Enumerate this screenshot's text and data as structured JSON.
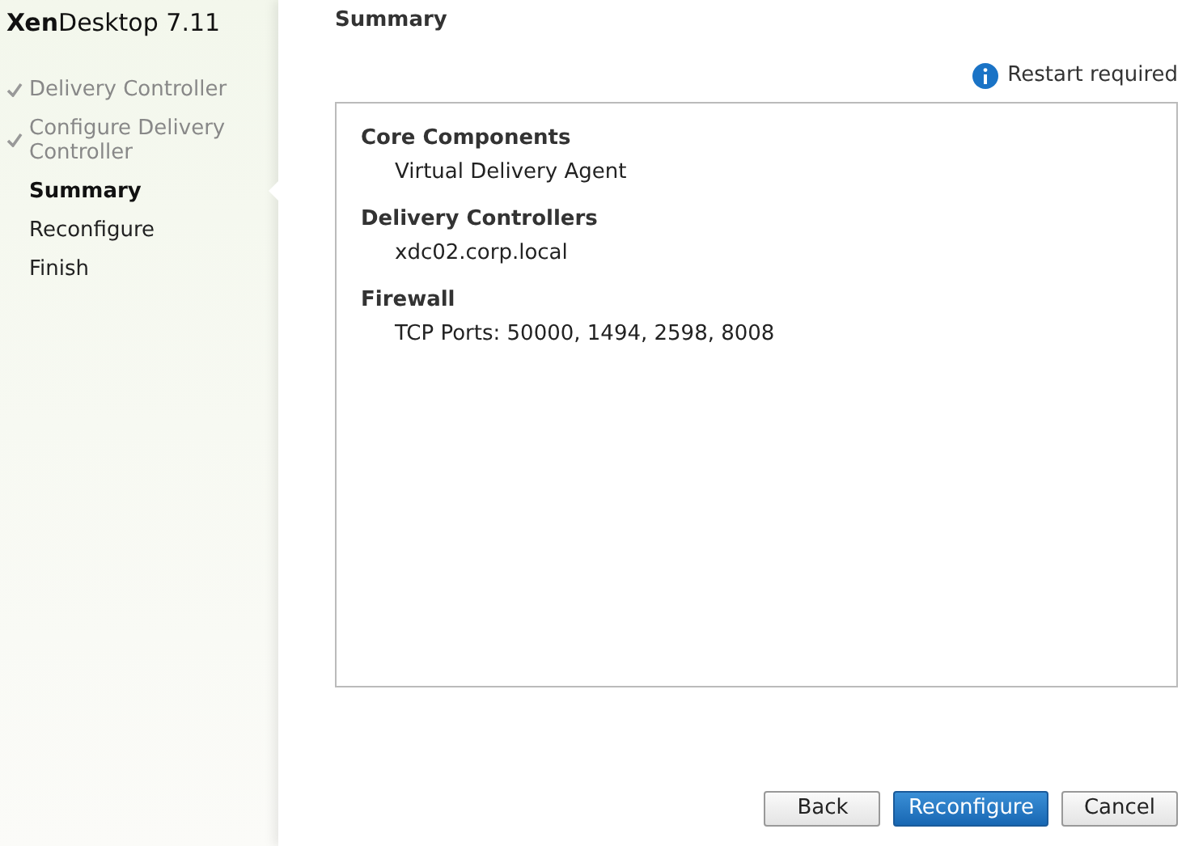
{
  "product": "**Xen**Desktop 7.11",
  "steps": [
    {
      "label": "Delivery Controller",
      "done": true,
      "selected": false
    },
    {
      "label": "Configure Delivery Controller",
      "done": true,
      "selected": false
    },
    {
      "label": "Summary",
      "done": false,
      "selected": true
    },
    {
      "label": "Reconfigure",
      "done": false,
      "selected": false
    },
    {
      "label": "Finish",
      "done": false,
      "selected": false
    }
  ],
  "page_title": "Summary",
  "notice": "Restart required",
  "summary": [
    {
      "heading": "Core Components",
      "value": "Virtual Delivery Agent"
    },
    {
      "heading": "Delivery Controllers",
      "value": "xdc02.corp.local"
    },
    {
      "heading": "Firewall",
      "value": "TCP Ports:  50000, 1494, 2598, 8008"
    }
  ],
  "buttons": [
    {
      "label": "Back",
      "primary": false
    },
    {
      "label": "Reconfigure",
      "primary": true
    },
    {
      "label": "Cancel",
      "primary": false
    }
  ]
}
